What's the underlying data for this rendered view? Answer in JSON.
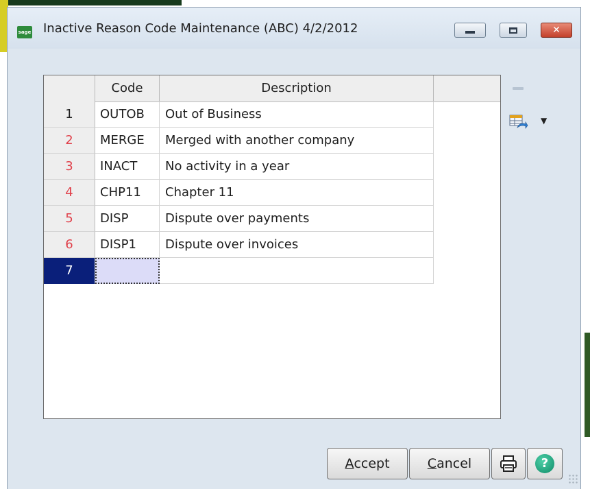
{
  "window": {
    "app_icon_text": "sage",
    "title": "Inactive Reason Code Maintenance (ABC) 4/2/2012"
  },
  "grid": {
    "columns": {
      "code": "Code",
      "description": "Description"
    },
    "rows": [
      {
        "num": "1",
        "code": "OUTOB",
        "description": "Out of Business"
      },
      {
        "num": "2",
        "code": "MERGE",
        "description": "Merged with another company"
      },
      {
        "num": "3",
        "code": "INACT",
        "description": "No activity in a year"
      },
      {
        "num": "4",
        "code": "CHP11",
        "description": "Chapter 11"
      },
      {
        "num": "5",
        "code": "DISP",
        "description": "Dispute over payments"
      },
      {
        "num": "6",
        "code": "DISP1",
        "description": "Dispute over invoices"
      },
      {
        "num": "7",
        "code": "",
        "description": ""
      }
    ],
    "selected_row": "7"
  },
  "buttons": {
    "accept_mnemonic": "A",
    "accept_rest": "ccept",
    "cancel_mnemonic": "C",
    "cancel_rest": "ancel"
  },
  "icons": {
    "minimize": "minimize-icon",
    "maximize": "maximize-icon",
    "close": "close-icon",
    "print": "printer-icon",
    "help": "help-icon",
    "grid_tool": "grid-settings-icon"
  },
  "colors": {
    "row_number_red": "#e0404a",
    "selected_row": "#0a1f7a",
    "help_green": "#0e8b67"
  }
}
